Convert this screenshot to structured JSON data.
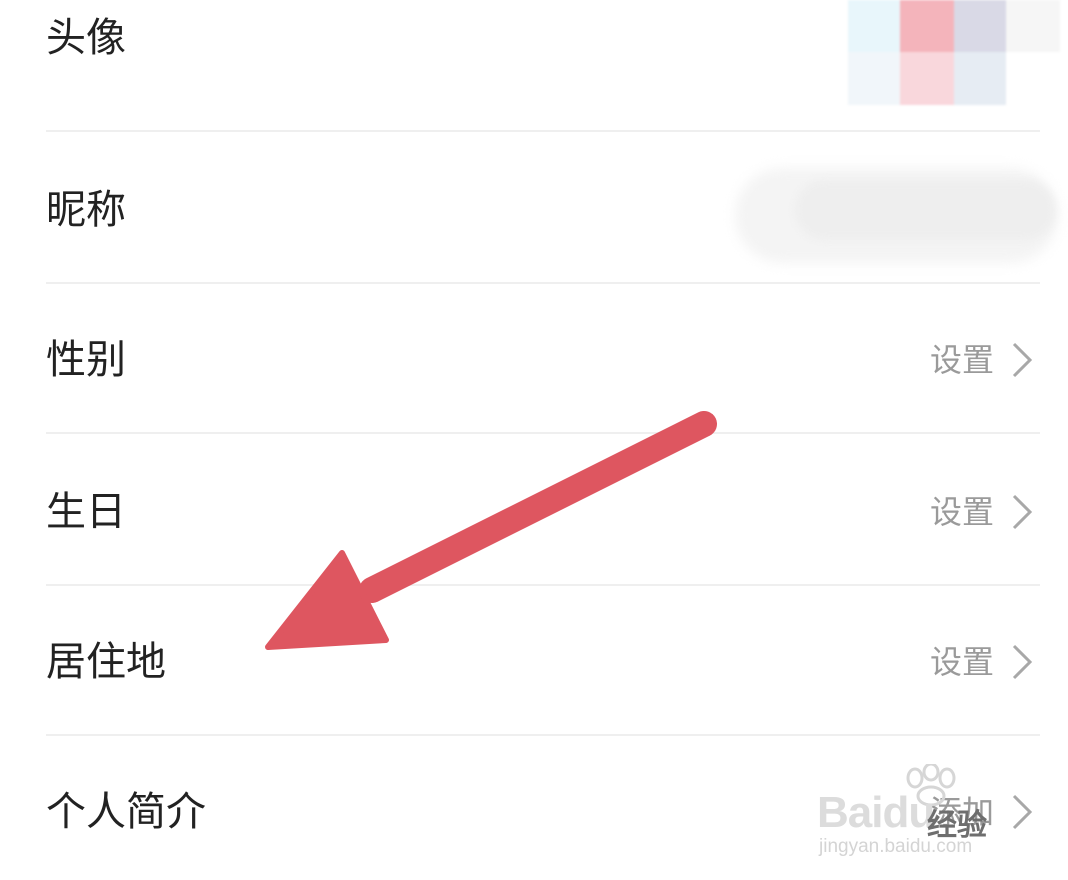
{
  "rows": [
    {
      "label": "头像",
      "value": ""
    },
    {
      "label": "昵称",
      "value": ""
    },
    {
      "label": "性别",
      "value": "设置"
    },
    {
      "label": "生日",
      "value": "设置"
    },
    {
      "label": "居住地",
      "value": "设置"
    },
    {
      "label": "个人简介",
      "value": "添加"
    }
  ],
  "watermark": {
    "brand": "Baidu",
    "product": "经验",
    "domain": "jingyan.baidu.com"
  },
  "colors": {
    "annotation_arrow": "#de5660",
    "label_text": "#222222",
    "value_text": "#9a9a9a",
    "divider": "#efefef"
  }
}
